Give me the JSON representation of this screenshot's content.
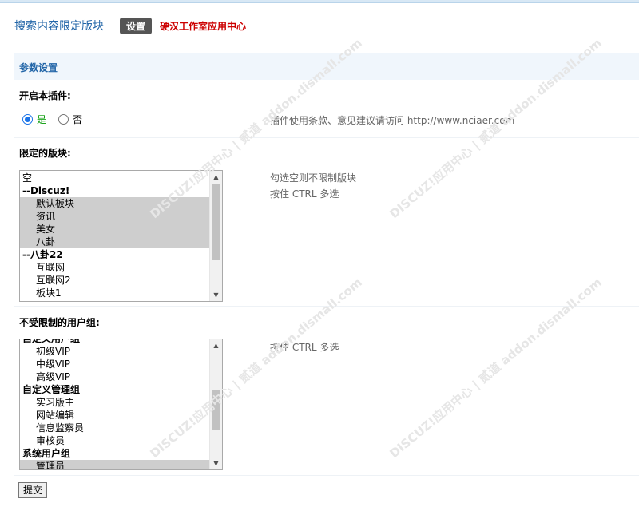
{
  "header": {
    "title": "搜索内容限定版块",
    "settings_label": "设置",
    "vendor_link": "硬汉工作室应用中心"
  },
  "section": {
    "title": "参数设置"
  },
  "plugin_enable": {
    "label": "开启本插件:",
    "yes_label": "是",
    "no_label": "否",
    "selected": "是",
    "hint": "插件使用条款、意见建议请访问 http://www.nciaer.com"
  },
  "forums": {
    "label": "限定的版块:",
    "hint_line1": "勾选空则不限制版块",
    "hint_line2": "按住 CTRL 多选",
    "options": [
      {
        "text": "空",
        "kind": "item",
        "selected": false
      },
      {
        "text": "--Discuz!",
        "kind": "group",
        "selected": false
      },
      {
        "text": "默认板块",
        "kind": "child",
        "selected": true
      },
      {
        "text": "资讯",
        "kind": "child",
        "selected": true
      },
      {
        "text": "美女",
        "kind": "child",
        "selected": true
      },
      {
        "text": "八卦",
        "kind": "child",
        "selected": true
      },
      {
        "text": "--八卦22",
        "kind": "group",
        "selected": false
      },
      {
        "text": "互联网",
        "kind": "child",
        "selected": false
      },
      {
        "text": "互联网2",
        "kind": "child",
        "selected": false
      },
      {
        "text": "板块1",
        "kind": "child",
        "selected": false
      }
    ]
  },
  "usergroups": {
    "label": "不受限制的用户组:",
    "hint": "按住 CTRL 多选",
    "options": [
      {
        "text": "自定义用户组",
        "kind": "group",
        "selected": false
      },
      {
        "text": "初级VIP",
        "kind": "child",
        "selected": false
      },
      {
        "text": "中级VIP",
        "kind": "child",
        "selected": false
      },
      {
        "text": "高级VIP",
        "kind": "child",
        "selected": false
      },
      {
        "text": "自定义管理组",
        "kind": "group",
        "selected": false
      },
      {
        "text": "实习版主",
        "kind": "child",
        "selected": false
      },
      {
        "text": "网站编辑",
        "kind": "child",
        "selected": false
      },
      {
        "text": "信息监察员",
        "kind": "child",
        "selected": false
      },
      {
        "text": "审核员",
        "kind": "child",
        "selected": false
      },
      {
        "text": "系统用户组",
        "kind": "group",
        "selected": false
      },
      {
        "text": "管理员",
        "kind": "child",
        "selected": true
      }
    ]
  },
  "submit_label": "提交",
  "watermark_text": "DISCUZ!应用中心 | 贰道 addon.dismall.com"
}
